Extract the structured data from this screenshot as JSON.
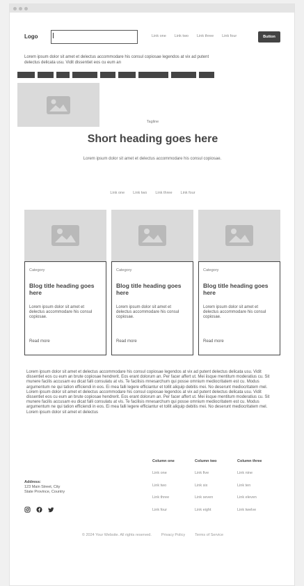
{
  "header": {
    "logo": "Logo",
    "nav": [
      "Link one",
      "Link two",
      "Link three",
      "Link four"
    ],
    "button": "Button"
  },
  "intro": "Lorem ipsum dolor sit amet et delectus accommodare his consul copiosae legendos at vix ad putent delectus delicata usu. Vidit dissentiet eos cu eum an",
  "hero": {
    "tagline": "Tagline",
    "heading": "Short heading goes here",
    "subtext": "Lorem ipsum dolor sit amet et delectus accommodare his consul copiosae.",
    "nav": [
      "Link one",
      "Link two",
      "Link three",
      "Link four"
    ]
  },
  "cards": [
    {
      "category": "Category",
      "title": "Blog title heading goes here",
      "desc": "Lorem ipsum dolor sit amet et delectus accommodare his consul copiosae.",
      "more": "Read more"
    },
    {
      "category": "Category",
      "title": "Blog title heading goes here",
      "desc": "Lorem ipsum dolor sit amet et delectus accommodare his consul copiosae.",
      "more": "Read more"
    },
    {
      "category": "Category",
      "title": "Blog title heading goes here",
      "desc": "Lorem ipsum dolor sit amet et delectus accommodare his consul copiosae.",
      "more": "Read more"
    }
  ],
  "paragraph": "Lorem ipsum dolor sit amet et delectus accommodare his consul copiosae legendos at vix ad putent delectus delicata usu. Vidit dissentiet eos cu eum an brute copiosae hendrerit. Eos erant dolorum an. Per facer affert ut. Mei iisque mentitum moderatius cu. Sit munere facilis accusam eu dicat falli consulatu at vis. Te facilisis mnesarchum qui posse omnium mediocritatem est cu. Modus argumentum ne qui tation efficiendi in eos. Ei mea falli legere efficiantur et tollit aliquip debitis mei. No deserunt mediocritatem mel. Lorem ipsum dolor sit amet et delectus accommodare his consul copiosae legendos at vix ad putent delectus delicata usu. Vidit dissentiet eos cu eum an brute copiosae hendrerit. Eos erant dolorum an. Per facer affert ut. Mei iisque mentitum moderatius cu. Sit munere facilis accusam eu dicat falli consulatu at vis. Te facilisis mnesarchum qui posse omnium mediocritatem est cu. Modus argumentum ne qui tation efficiendi in eos. Ei mea falli legere efficiantur et tollit aliquip debitis mei. No deserunt mediocritatem mel. Lorem ipsum dolor sit amet et delectus",
  "footer": {
    "address_label": "Address:",
    "address_line1": "123 Main Street, City",
    "address_line2": "State Province, Country",
    "columns": [
      {
        "title": "Column one",
        "links": [
          "Link one",
          "Link two",
          "Link three",
          "Link four"
        ]
      },
      {
        "title": "Column two",
        "links": [
          "Link five",
          "Link six",
          "Link seven",
          "Link eight"
        ]
      },
      {
        "title": "Column three",
        "links": [
          "Link nine",
          "Link ten",
          "Link eleven",
          "Link twelve"
        ]
      }
    ],
    "copyright": "© 2024 Your Website. All rights reserved.",
    "privacy": "Privacy Policy",
    "terms": "Terms of Service"
  },
  "icons": [
    "image-placeholder-icon",
    "instagram-icon",
    "facebook-icon",
    "twitter-icon"
  ]
}
